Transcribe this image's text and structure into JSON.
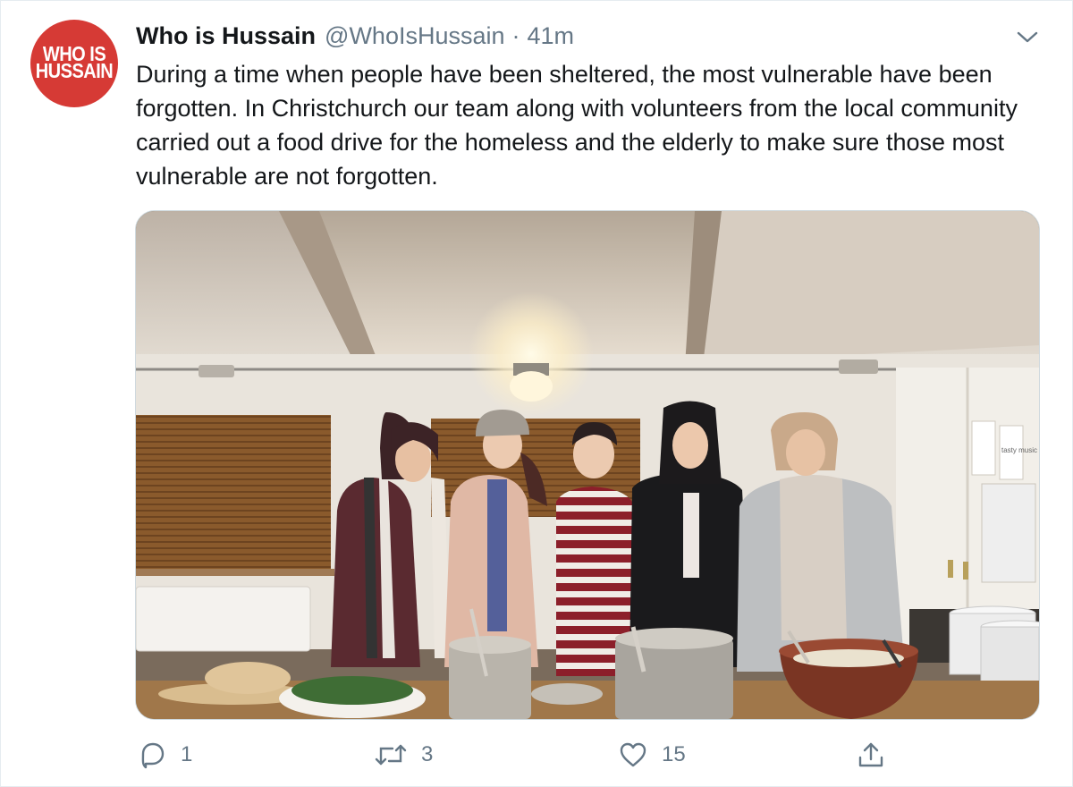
{
  "account": {
    "avatar_text_line1": "WHO IS",
    "avatar_text_line2": "HUSSAIN",
    "display_name": "Who is Hussain",
    "handle": "@WhoIsHussain",
    "separator": "·",
    "time": "41m"
  },
  "tweet": {
    "text": "During a time when people have been sheltered, the most vulnerable have been forgotten. In Christchurch our team along with volunteers from the local community carried out a food drive for the homeless and the elderly to make sure those most vulnerable are not forgotten."
  },
  "media": {
    "wall_notice_1": "",
    "wall_notice_2": "tasty music"
  },
  "actions": {
    "reply_count": "1",
    "retweet_count": "3",
    "like_count": "15"
  },
  "icons": {
    "more": "chevron-down-icon",
    "reply": "reply-icon",
    "retweet": "retweet-icon",
    "like": "heart-icon",
    "share": "share-icon"
  },
  "colors": {
    "avatar_bg": "#d63a35",
    "secondary_text": "#657786",
    "primary_text": "#14171a"
  }
}
